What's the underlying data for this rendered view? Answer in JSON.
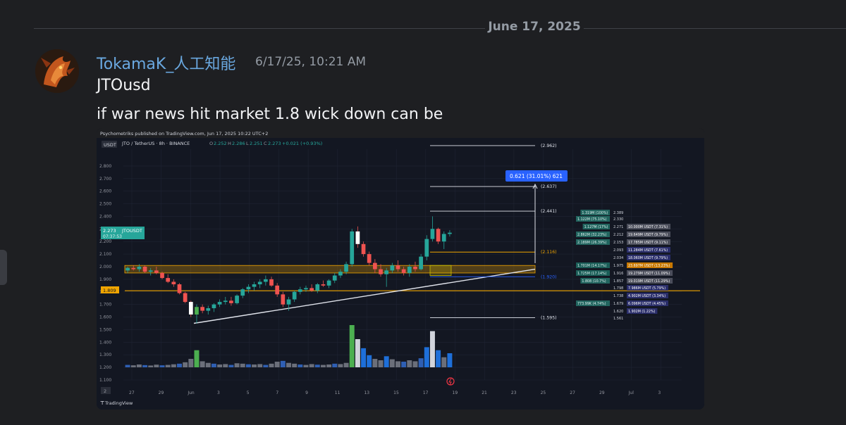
{
  "date_separator": "June 17, 2025",
  "message": {
    "author": "TokamaK_人工知能",
    "timestamp": "6/17/25, 10:21 AM",
    "lines": [
      "JTOusd",
      "if war news hit market 1.8 wick down can be"
    ]
  },
  "attachment": {
    "publisher": "Psychometriks published on TradingView.com, Jun 17, 2025 10:22 UTC+2",
    "footer_logo": "TradingView",
    "symbol_line": "JTO / TetherUS · 8h · BINANCE",
    "ohlc": {
      "o_label": "O",
      "o": "2.252",
      "h_label": "H",
      "h": "2.286",
      "l_label": "L",
      "l": "2.251",
      "c_label": "C",
      "c": "2.273",
      "change": "+0.021 (+0.93%)"
    },
    "currency": "USDT",
    "current_price": "2.273",
    "current_ticker": "JTOUSDT",
    "countdown": "07:37:53",
    "level_badge": "1.809",
    "measure_label": "0.621 (31.01%) 621",
    "bottom_left_button": "2"
  },
  "chart_data": {
    "type": "candlestick",
    "title": "JTO / TetherUS · 8h · BINANCE",
    "ylim": [
      1.1,
      2.9
    ],
    "y_ticks": [
      "2.800",
      "2.700",
      "2.600",
      "2.500",
      "2.400",
      "2.300",
      "2.200",
      "2.100",
      "2.000",
      "1.900",
      "1.800",
      "1.700",
      "1.600",
      "1.500",
      "1.400",
      "1.300",
      "1.200",
      "1.100"
    ],
    "x_ticks": [
      "27",
      "29",
      "Jun",
      "3",
      "5",
      "7",
      "9",
      "11",
      "13",
      "15",
      "17",
      "19",
      "21",
      "23",
      "25",
      "27",
      "29",
      "Jul",
      "3"
    ],
    "candles": [
      {
        "o": 1.97,
        "h": 2.0,
        "l": 1.95,
        "c": 1.99
      },
      {
        "o": 1.99,
        "h": 2.01,
        "l": 1.97,
        "c": 1.98
      },
      {
        "o": 1.98,
        "h": 2.02,
        "l": 1.96,
        "c": 2.0
      },
      {
        "o": 2.0,
        "h": 2.01,
        "l": 1.95,
        "c": 1.96
      },
      {
        "o": 1.96,
        "h": 1.99,
        "l": 1.93,
        "c": 1.97
      },
      {
        "o": 1.97,
        "h": 2.0,
        "l": 1.94,
        "c": 1.95
      },
      {
        "o": 1.95,
        "h": 1.96,
        "l": 1.9,
        "c": 1.91
      },
      {
        "o": 1.91,
        "h": 1.94,
        "l": 1.87,
        "c": 1.88
      },
      {
        "o": 1.88,
        "h": 1.9,
        "l": 1.84,
        "c": 1.86
      },
      {
        "o": 1.86,
        "h": 1.87,
        "l": 1.78,
        "c": 1.79
      },
      {
        "o": 1.79,
        "h": 1.8,
        "l": 1.71,
        "c": 1.72
      },
      {
        "o": 1.72,
        "h": 1.73,
        "l": 1.6,
        "c": 1.62
      },
      {
        "o": 1.62,
        "h": 1.7,
        "l": 1.55,
        "c": 1.68
      },
      {
        "o": 1.68,
        "h": 1.7,
        "l": 1.63,
        "c": 1.65
      },
      {
        "o": 1.65,
        "h": 1.69,
        "l": 1.62,
        "c": 1.67
      },
      {
        "o": 1.67,
        "h": 1.71,
        "l": 1.64,
        "c": 1.7
      },
      {
        "o": 1.7,
        "h": 1.74,
        "l": 1.68,
        "c": 1.72
      },
      {
        "o": 1.72,
        "h": 1.76,
        "l": 1.7,
        "c": 1.73
      },
      {
        "o": 1.73,
        "h": 1.76,
        "l": 1.69,
        "c": 1.71
      },
      {
        "o": 1.71,
        "h": 1.78,
        "l": 1.7,
        "c": 1.77
      },
      {
        "o": 1.77,
        "h": 1.83,
        "l": 1.75,
        "c": 1.82
      },
      {
        "o": 1.82,
        "h": 1.86,
        "l": 1.79,
        "c": 1.84
      },
      {
        "o": 1.84,
        "h": 1.88,
        "l": 1.81,
        "c": 1.86
      },
      {
        "o": 1.86,
        "h": 1.9,
        "l": 1.83,
        "c": 1.88
      },
      {
        "o": 1.88,
        "h": 1.93,
        "l": 1.85,
        "c": 1.9
      },
      {
        "o": 1.9,
        "h": 1.92,
        "l": 1.84,
        "c": 1.85
      },
      {
        "o": 1.85,
        "h": 1.87,
        "l": 1.76,
        "c": 1.78
      },
      {
        "o": 1.78,
        "h": 1.8,
        "l": 1.68,
        "c": 1.7
      },
      {
        "o": 1.7,
        "h": 1.76,
        "l": 1.65,
        "c": 1.74
      },
      {
        "o": 1.74,
        "h": 1.81,
        "l": 1.72,
        "c": 1.8
      },
      {
        "o": 1.8,
        "h": 1.84,
        "l": 1.78,
        "c": 1.82
      },
      {
        "o": 1.82,
        "h": 1.85,
        "l": 1.8,
        "c": 1.83
      },
      {
        "o": 1.83,
        "h": 1.86,
        "l": 1.8,
        "c": 1.81
      },
      {
        "o": 1.81,
        "h": 1.87,
        "l": 1.79,
        "c": 1.86
      },
      {
        "o": 1.86,
        "h": 1.89,
        "l": 1.84,
        "c": 1.85
      },
      {
        "o": 1.85,
        "h": 1.9,
        "l": 1.83,
        "c": 1.89
      },
      {
        "o": 1.89,
        "h": 1.95,
        "l": 1.87,
        "c": 1.93
      },
      {
        "o": 1.93,
        "h": 1.98,
        "l": 1.91,
        "c": 1.96
      },
      {
        "o": 1.96,
        "h": 2.04,
        "l": 1.94,
        "c": 2.02
      },
      {
        "o": 2.02,
        "h": 2.3,
        "l": 2.0,
        "c": 2.28
      },
      {
        "o": 2.28,
        "h": 2.32,
        "l": 2.15,
        "c": 2.18
      },
      {
        "o": 2.18,
        "h": 2.2,
        "l": 2.08,
        "c": 2.1
      },
      {
        "o": 2.1,
        "h": 2.12,
        "l": 2.01,
        "c": 2.03
      },
      {
        "o": 2.03,
        "h": 2.06,
        "l": 1.95,
        "c": 1.98
      },
      {
        "o": 1.98,
        "h": 2.02,
        "l": 1.92,
        "c": 1.94
      },
      {
        "o": 1.94,
        "h": 1.99,
        "l": 1.84,
        "c": 1.97
      },
      {
        "o": 1.97,
        "h": 2.03,
        "l": 1.95,
        "c": 2.01
      },
      {
        "o": 2.01,
        "h": 2.05,
        "l": 1.96,
        "c": 1.98
      },
      {
        "o": 1.98,
        "h": 2.0,
        "l": 1.93,
        "c": 1.95
      },
      {
        "o": 1.95,
        "h": 2.02,
        "l": 1.92,
        "c": 2.0
      },
      {
        "o": 2.0,
        "h": 2.04,
        "l": 1.96,
        "c": 1.98
      },
      {
        "o": 1.98,
        "h": 2.1,
        "l": 1.97,
        "c": 2.08
      },
      {
        "o": 2.08,
        "h": 2.25,
        "l": 2.05,
        "c": 2.22
      },
      {
        "o": 2.22,
        "h": 2.4,
        "l": 2.2,
        "c": 2.3
      },
      {
        "o": 2.3,
        "h": 2.31,
        "l": 2.18,
        "c": 2.2
      },
      {
        "o": 2.2,
        "h": 2.28,
        "l": 2.14,
        "c": 2.26
      },
      {
        "o": 2.26,
        "h": 2.29,
        "l": 2.24,
        "c": 2.27
      }
    ],
    "volume": [
      0.12,
      0.1,
      0.14,
      0.11,
      0.09,
      0.13,
      0.1,
      0.12,
      0.15,
      0.18,
      0.25,
      0.42,
      0.85,
      0.3,
      0.22,
      0.18,
      0.14,
      0.16,
      0.12,
      0.2,
      0.18,
      0.15,
      0.14,
      0.16,
      0.12,
      0.18,
      0.28,
      0.32,
      0.22,
      0.18,
      0.14,
      0.12,
      0.16,
      0.13,
      0.12,
      0.14,
      0.18,
      0.16,
      0.22,
      2.1,
      1.4,
      0.95,
      0.6,
      0.42,
      0.35,
      0.55,
      0.4,
      0.3,
      0.28,
      0.35,
      0.3,
      0.45,
      1.0,
      1.8,
      0.85,
      0.5,
      0.7
    ],
    "volume_colors_note": "volume bars colored blue/white/grey/green",
    "levels": [
      {
        "value": "(2.962)"
      },
      {
        "value": "(2.637)"
      },
      {
        "value": "(2.441)"
      },
      {
        "value": "(2.116)"
      },
      {
        "value": "(1.920)"
      },
      {
        "value": "(1.595)"
      }
    ],
    "support_zone": [
      1.95,
      2.01
    ],
    "horizontal_line": 1.809,
    "trendline": {
      "from": [
        0.0,
        1.55
      ],
      "to": [
        1.0,
        1.98
      ]
    },
    "order_book": [
      {
        "qty": "1.319M (100%)",
        "price": "2.389",
        "usdt": ""
      },
      {
        "qty": "1.122M (75.10%)",
        "price": "2.330",
        "usdt": ""
      },
      {
        "qty": "1.127M (17%)",
        "price": "2.271",
        "usdt": "10.000M USDT (7.31%)"
      },
      {
        "qty": "2.862M (32.23%)",
        "price": "2.212",
        "usdt": "19.649M USDT (9.79%)"
      },
      {
        "qty": "2.189M (26.39%)",
        "price": "2.153",
        "usdt": "17.785M USDT (9.11%)"
      },
      {
        "qty": "",
        "price": "2.093",
        "usdt": "11.284M USDT (7.61%)"
      },
      {
        "qty": "",
        "price": "2.034",
        "usdt": "18.060M USDT (9.79%)"
      },
      {
        "qty": "1.701M (14.17%)",
        "price": "1.975",
        "usdt": "23.697M USDT (13.23%)"
      },
      {
        "qty": "1.725M (17.14%)",
        "price": "1.916",
        "usdt": "19.279M USDT (11.09%)"
      },
      {
        "qty": "1.808 (10.7%)",
        "price": "1.857",
        "usdt": "19.019M USDT (11.29%)"
      },
      {
        "qty": "",
        "price": "1.798",
        "usdt": "7.986M USDT (5.79%)"
      },
      {
        "qty": "",
        "price": "1.738",
        "usdt": "4.902M USDT (3.34%)"
      },
      {
        "qty": "773.99K (4.74%)",
        "price": "1.679",
        "usdt": "6.096M USDT (4.45%)"
      },
      {
        "qty": "",
        "price": "1.620",
        "usdt": "1.902M (1.22%)"
      },
      {
        "qty": "",
        "price": "1.561",
        "usdt": ""
      }
    ]
  },
  "colors": {
    "bg": "#1e1f22",
    "chart_bg": "#131722",
    "up": "#26a69a",
    "down": "#ef5350",
    "zone": "#f0a500",
    "line_orange": "#f0a500",
    "measure": "#2962ff",
    "author": "#6aa8e0"
  }
}
